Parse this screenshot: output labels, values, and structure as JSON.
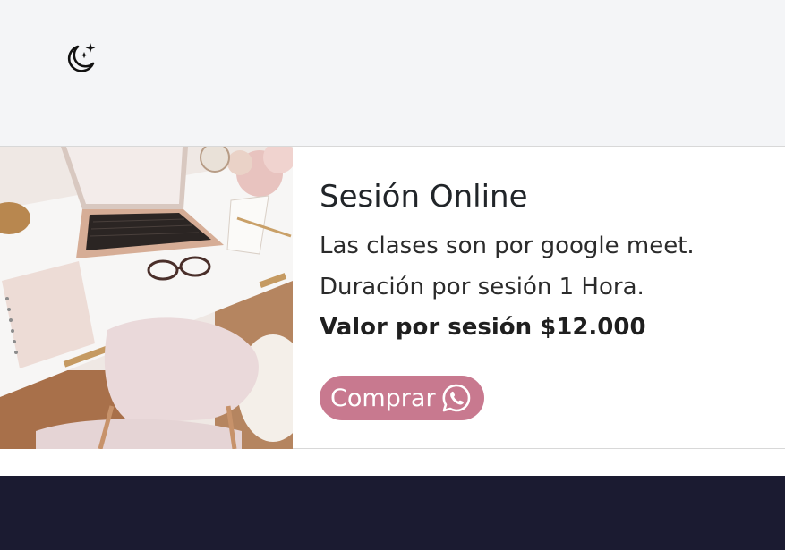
{
  "header": {
    "theme_toggle_icon": "moon-stars-icon"
  },
  "card": {
    "image_icon": "laptop-desk-photo",
    "title": "Sesión Online",
    "line1": "Las clases son por google meet.",
    "line2": "Duración por sesión 1 Hora.",
    "price": "Valor por sesión $12.000",
    "button_label": "Comprar",
    "button_icon": "whatsapp-icon",
    "button_color": "#c8798f"
  },
  "colors": {
    "header_bg": "#f4f5f7",
    "footer_bg": "#1b1b31"
  }
}
